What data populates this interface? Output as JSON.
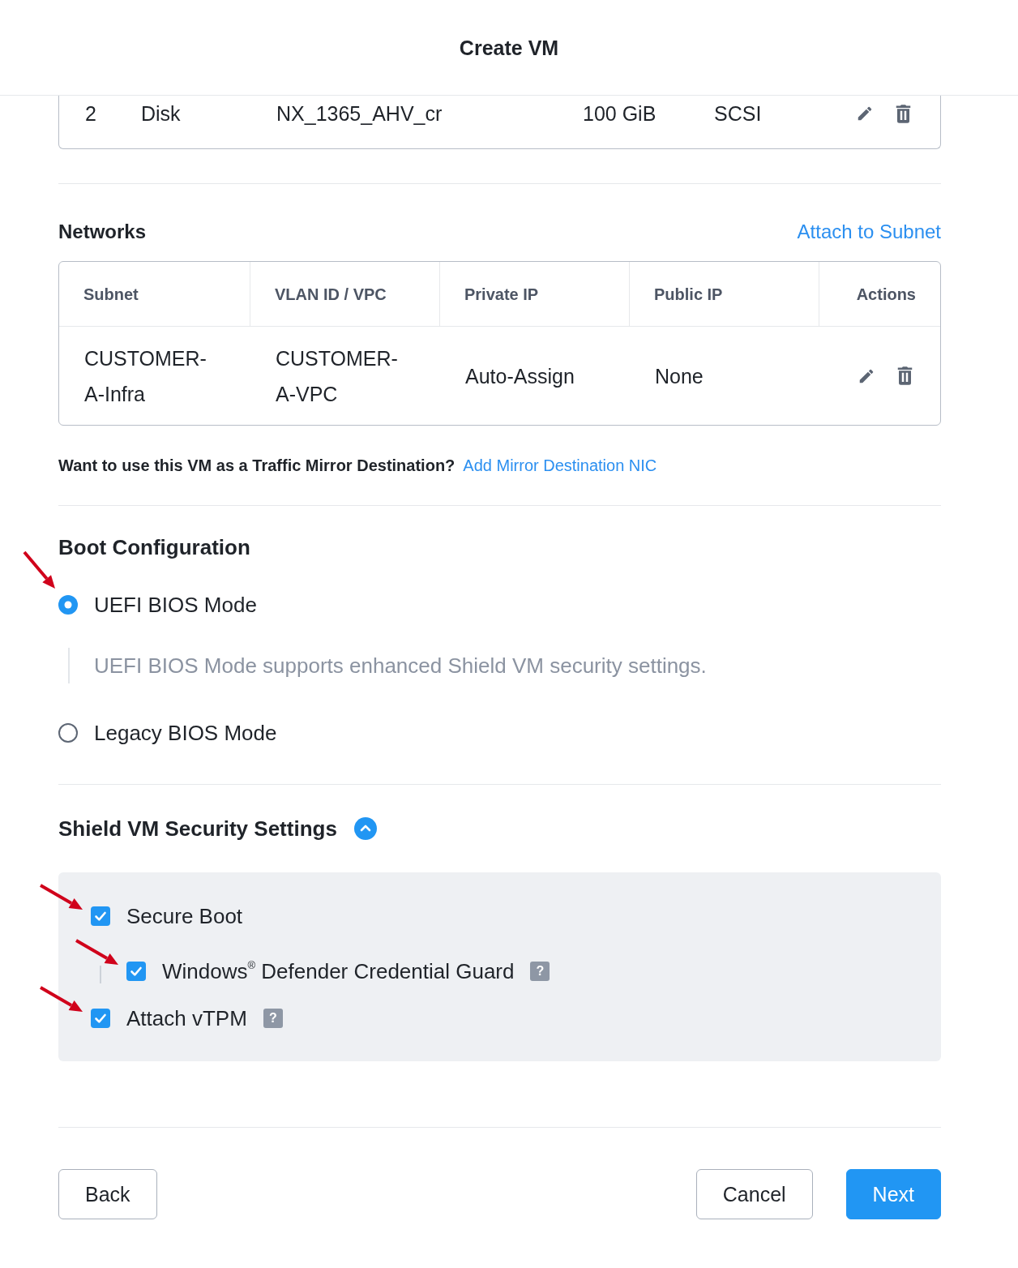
{
  "window": {
    "title": "Create VM"
  },
  "disk_table": {
    "rows": [
      {
        "cells": [
          "2",
          "Disk",
          "NX_1365_AHV_cr",
          "100 GiB",
          "SCSI"
        ]
      }
    ]
  },
  "networks": {
    "title": "Networks",
    "attach_link": "Attach to Subnet",
    "columns": [
      "Subnet",
      "VLAN ID / VPC",
      "Private IP",
      "Public IP",
      "Actions"
    ],
    "rows": [
      {
        "cells": [
          "CUSTOMER-A-Infra",
          "CUSTOMER-A-VPC",
          "Auto-Assign",
          "None"
        ]
      }
    ]
  },
  "mirror": {
    "question": "Want to use this VM as a Traffic Mirror Destination?",
    "link": "Add Mirror Destination NIC"
  },
  "boot_configuration": {
    "title": "Boot Configuration",
    "options": [
      {
        "label": "UEFI BIOS Mode",
        "selected": true,
        "arrow_marker": true,
        "description": "UEFI BIOS Mode supports enhanced Shield VM security settings."
      },
      {
        "label": "Legacy BIOS Mode",
        "selected": false,
        "arrow_marker": false
      }
    ]
  },
  "shield_settings": {
    "title": "Shield VM Security Settings",
    "expanded": true,
    "options": [
      {
        "label": "Secure Boot",
        "checked": true,
        "arrow_marker": true,
        "children": [
          {
            "label": "Windows$^{®}$ Defender Credential Guard",
            "checked": true,
            "arrow_marker": true,
            "help": "?"
          }
        ]
      },
      {
        "label": "Attach vTPM",
        "checked": true,
        "arrow_marker": true,
        "help": "?"
      }
    ]
  },
  "footer": {
    "left": [
      {
        "label": "Back",
        "kind": "secondary"
      }
    ],
    "right": [
      {
        "label": "Cancel",
        "kind": "secondary"
      },
      {
        "label": "Next",
        "kind": "primary"
      }
    ]
  }
}
